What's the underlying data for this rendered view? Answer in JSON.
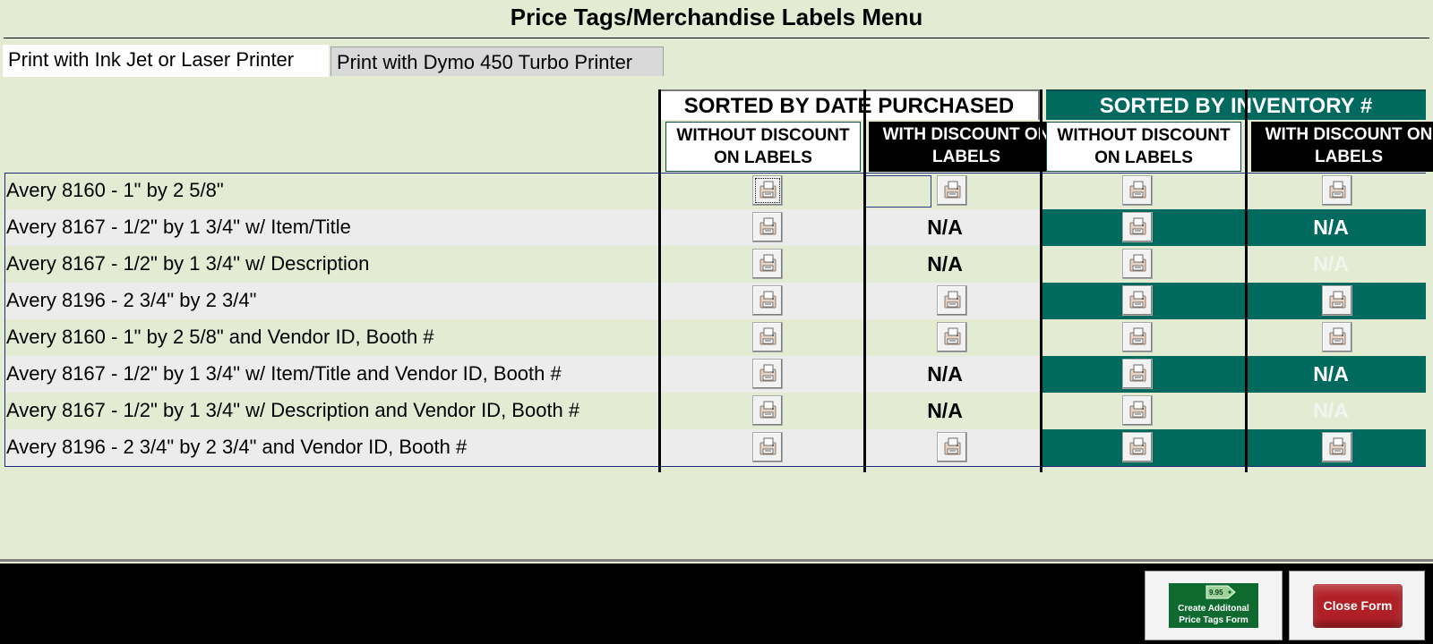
{
  "title": "Price Tags/Merchandise Labels Menu",
  "tabs": [
    {
      "label": "Print with Ink Jet or Laser Printer",
      "active": true
    },
    {
      "label": "Print with Dymo 450 Turbo Printer",
      "active": false
    }
  ],
  "headers": {
    "date": "SORTED BY DATE PURCHASED",
    "inventory": "SORTED BY INVENTORY #",
    "col1": "WITHOUT DISCOUNT ON LABELS",
    "col2": "WITH DISCOUNT ON LABELS",
    "col3": "WITHOUT DISCOUNT ON LABELS",
    "col4": "WITH DISCOUNT ON LABELS"
  },
  "rows": [
    {
      "label": "Avery 8160 - 1\" by 2 5/8\"",
      "cells": [
        "print",
        "print",
        "print",
        "print"
      ]
    },
    {
      "label": "Avery 8167 - 1/2\" by 1 3/4\" w/ Item/Title",
      "cells": [
        "print",
        "N/A",
        "print",
        "N/A"
      ]
    },
    {
      "label": "Avery 8167 - 1/2\" by 1 3/4\" w/ Description",
      "cells": [
        "print",
        "N/A",
        "print",
        "N/A"
      ]
    },
    {
      "label": "Avery 8196 - 2 3/4\" by 2 3/4\"",
      "cells": [
        "print",
        "print",
        "print",
        "print"
      ]
    },
    {
      "label": "Avery 8160 - 1\" by 2 5/8\" and Vendor ID, Booth  #",
      "cells": [
        "print",
        "print",
        "print",
        "print"
      ]
    },
    {
      "label": "Avery 8167 - 1/2\" by 1 3/4\" w/ Item/Title and Vendor ID, Booth  #",
      "cells": [
        "print",
        "N/A",
        "print",
        "N/A"
      ]
    },
    {
      "label": "Avery 8167 - 1/2\" by 1 3/4\" w/ Description and Vendor ID, Booth  #",
      "cells": [
        "print",
        "N/A",
        "print",
        "N/A"
      ]
    },
    {
      "label": "Avery 8196 - 2 3/4\" by 2 3/4\" and Vendor ID, Booth  #",
      "cells": [
        "print",
        "print",
        "print",
        "print"
      ]
    }
  ],
  "na_text": "N/A",
  "footer": {
    "create_label": "Create Additonal Price Tags  Form",
    "tag_text": "9.95",
    "close_label": "Close Form"
  },
  "colors": {
    "background": "#e3ebd3",
    "teal": "#006a5e",
    "black": "#000000",
    "row_alt": "#ececec",
    "close_red": "#b12026",
    "create_green": "#0f6a2f"
  },
  "icons": {
    "print": "printer-icon"
  }
}
